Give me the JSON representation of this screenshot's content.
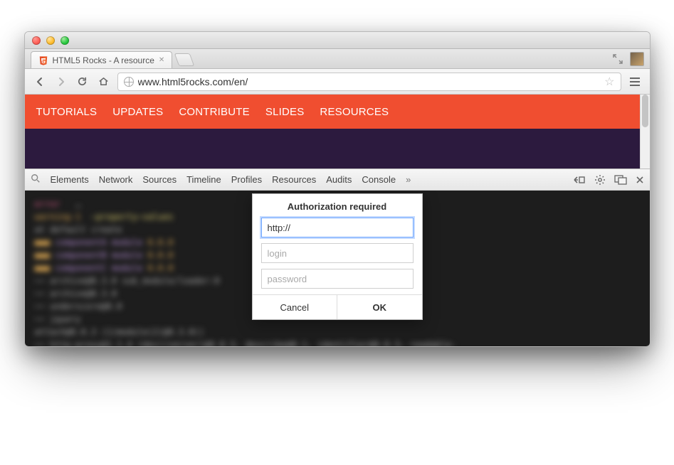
{
  "window": {
    "tab_title": "HTML5 Rocks - A resource"
  },
  "toolbar": {
    "url": "www.html5rocks.com/en/"
  },
  "site_nav": [
    "TUTORIALS",
    "UPDATES",
    "CONTRIBUTE",
    "SLIDES",
    "RESOURCES"
  ],
  "devtools": {
    "panels": [
      "Elements",
      "Network",
      "Sources",
      "Timeline",
      "Profiles",
      "Resources",
      "Audits",
      "Console"
    ]
  },
  "dialog": {
    "title": "Authorization required",
    "url_value": "http://",
    "login_placeholder": "login",
    "password_placeholder": "password",
    "cancel": "Cancel",
    "ok": "OK"
  }
}
